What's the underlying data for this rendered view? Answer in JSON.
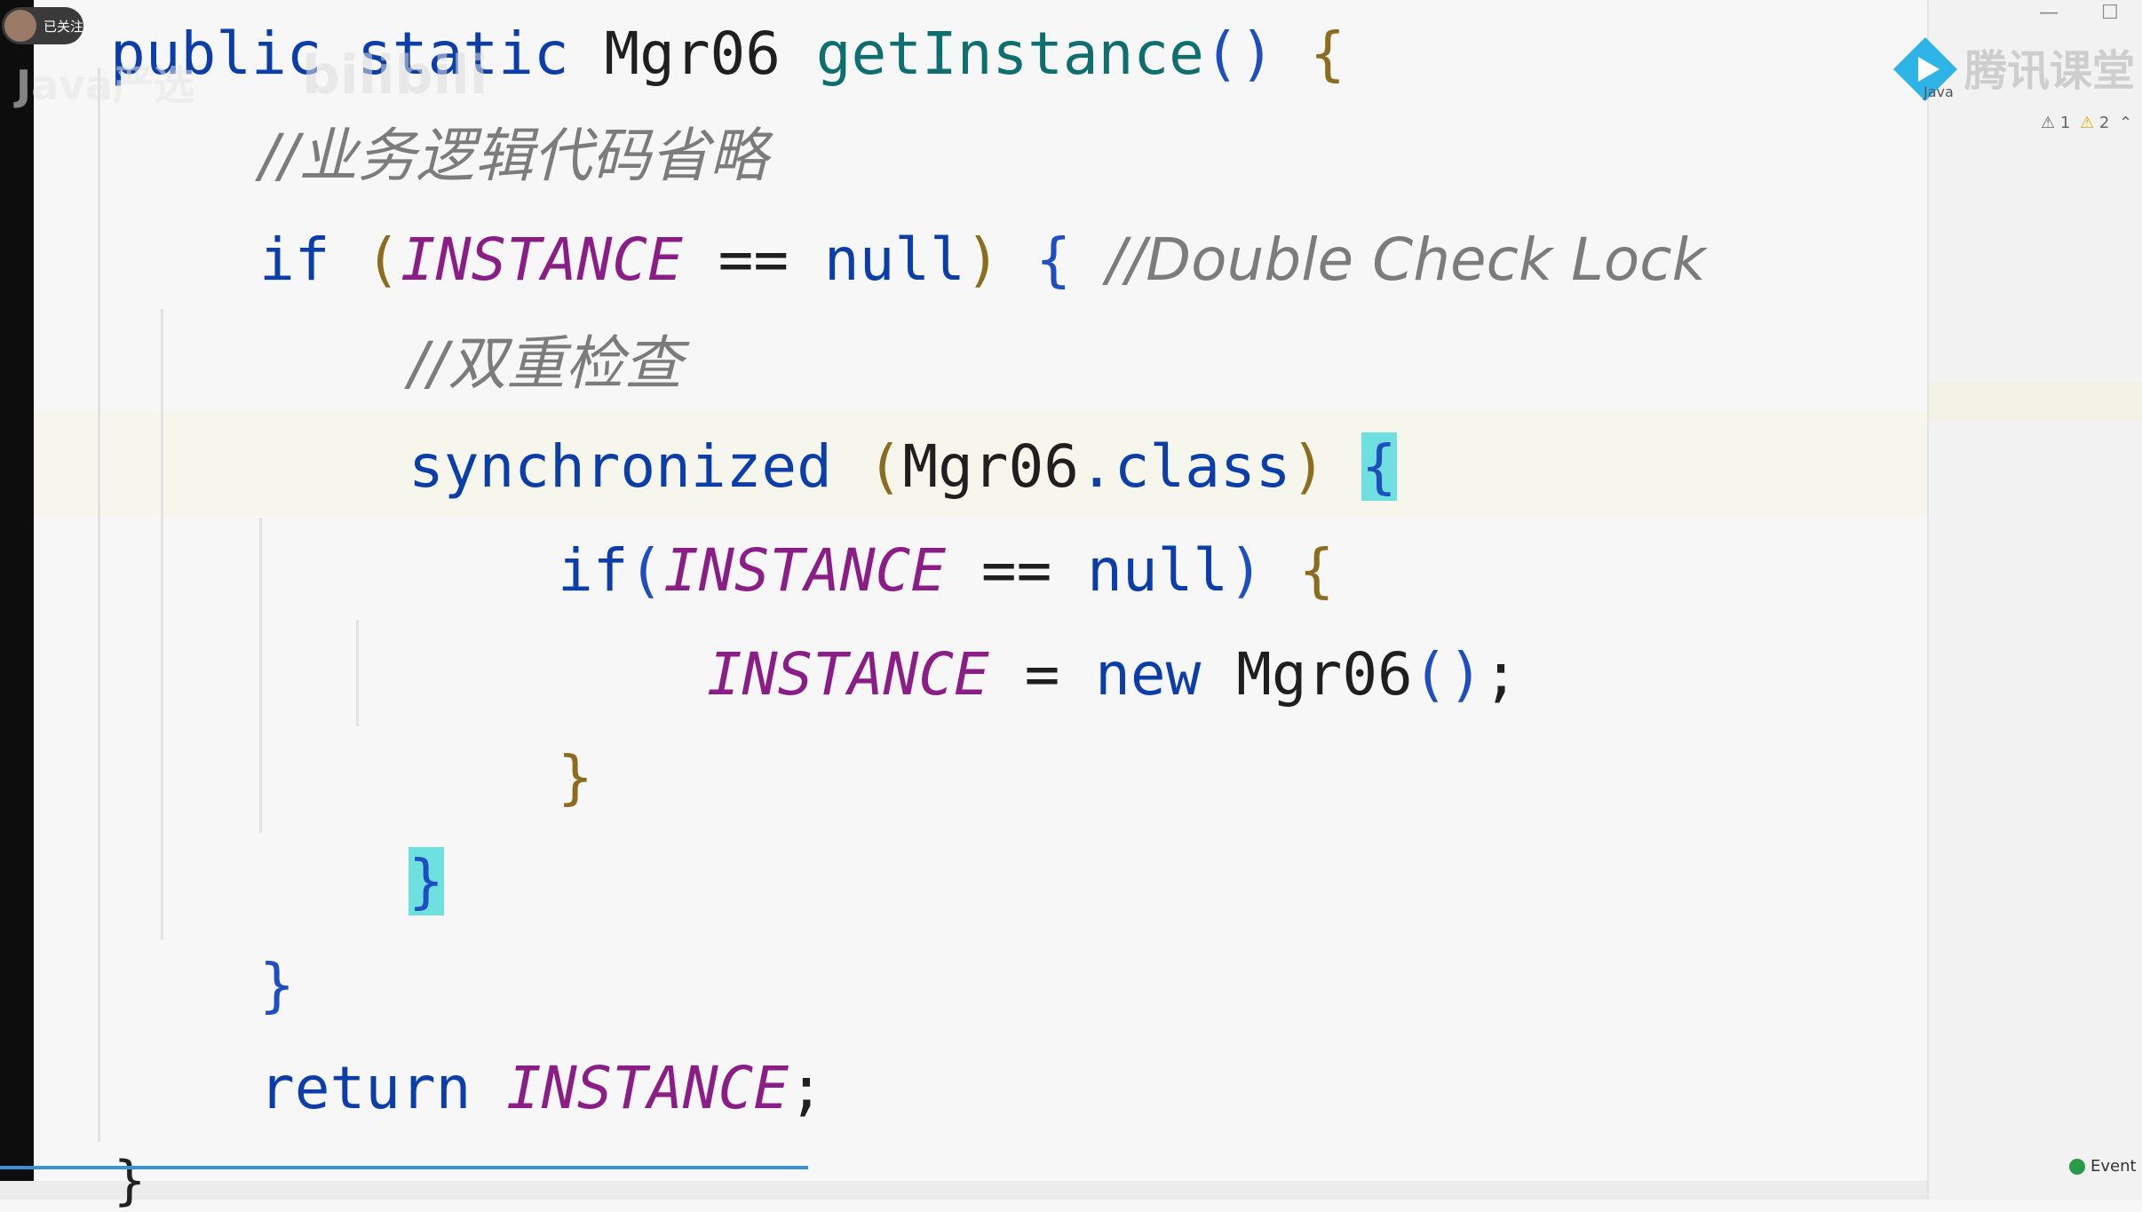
{
  "follow_badge": {
    "label": "已关注"
  },
  "watermark": {
    "left": "Java严选",
    "bilibili": "bilibili"
  },
  "brand": {
    "tencent_text": "腾讯课堂",
    "java_label": "Java"
  },
  "inspections": {
    "weak_warnings": "1",
    "warnings": "2"
  },
  "status_bar": {
    "event_log": "Event L"
  },
  "code": {
    "l1": {
      "public": "public",
      "static": "static",
      "type": "Mgr06",
      "method": "getInstance",
      "parens": "()",
      "brace": "{"
    },
    "l2": {
      "comment": "//业务逻辑代码省略"
    },
    "l3": {
      "if": "if",
      "open": "(",
      "instance": "INSTANCE",
      "op": "==",
      "null": "null",
      "close": ")",
      "brace": "{",
      "comment": "//Double Check Lock"
    },
    "l4": {
      "comment": "//双重检查"
    },
    "l5": {
      "sync": "synchronized",
      "open": "(",
      "type": "Mgr06",
      "dotclass": ".class",
      "close": ")",
      "brace": "{"
    },
    "l6": {
      "if": "if",
      "open": "(",
      "instance": "INSTANCE",
      "op": "==",
      "null": "null",
      "close": ")",
      "brace": "{"
    },
    "l7": {
      "instance": "INSTANCE",
      "assign": "=",
      "new": "new",
      "type": "Mgr06",
      "parens": "()",
      "semi": ";"
    },
    "l8": {
      "brace": "}"
    },
    "l9": {
      "brace": "}"
    },
    "l10": {
      "brace": "}"
    },
    "l11": {
      "return": "return",
      "instance": "INSTANCE",
      "semi": ";"
    },
    "l12": {
      "brace": "}"
    }
  }
}
